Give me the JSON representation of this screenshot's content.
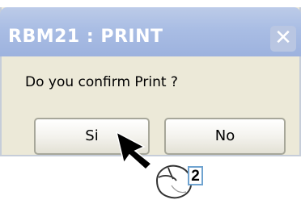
{
  "dialog": {
    "title": "RBM21 : PRINT",
    "close_glyph": "✕",
    "message": "Do you confirm Print ?",
    "buttons": {
      "yes_label": "Si",
      "no_label": "No"
    }
  },
  "annotation": {
    "step_number": "2",
    "pointer_icon": "arrow-cursor-icon",
    "device_icon": "mouse-icon"
  },
  "colors": {
    "titlebar": "#a9bde4",
    "dialog_body": "#ece9d8",
    "badge_border": "#6fa3d0"
  }
}
